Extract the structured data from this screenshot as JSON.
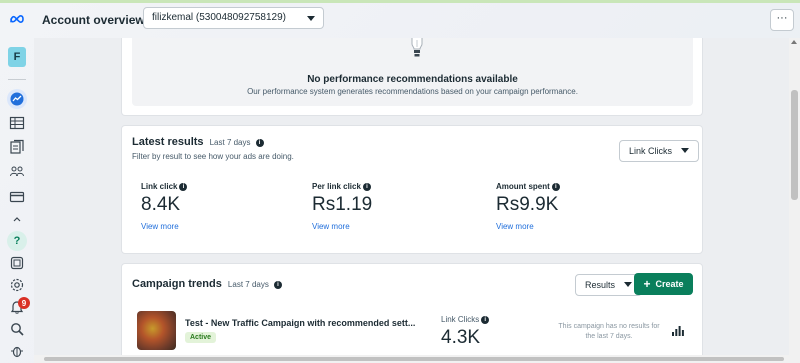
{
  "header": {
    "title": "Account overview",
    "account_select": "filizkemal (530048092758129)",
    "more_label": "···"
  },
  "rail": {
    "avatar_letter": "F",
    "notification_count": "9",
    "help_label": "?"
  },
  "recommendations": {
    "title": "No performance recommendations available",
    "description": "Our performance system generates recommendations based on your campaign performance."
  },
  "latest_results": {
    "title": "Latest results",
    "period": "Last 7 days",
    "description": "Filter by result to see how your ads are doing.",
    "filter_button": "Link Clicks",
    "metrics": [
      {
        "label": "Link click",
        "value": "8.4K",
        "link": "View more"
      },
      {
        "label": "Per link click",
        "value": "Rs1.19",
        "link": "View more"
      },
      {
        "label": "Amount spent",
        "value": "Rs9.9K",
        "link": "View more"
      }
    ]
  },
  "campaign_trends": {
    "title": "Campaign trends",
    "period": "Last 7 days",
    "results_button": "Results",
    "create_button": "Create",
    "campaign": {
      "name": "Test - New Traffic Campaign with recommended sett...",
      "status": "Active",
      "metric_label": "Link Clicks",
      "metric_value": "4.3K",
      "note": "This campaign has no results for the last 7 days."
    }
  },
  "colors": {
    "accent_green": "#0a7f5c",
    "link_blue": "#216fdb",
    "meta_blue": "#0866ff"
  }
}
